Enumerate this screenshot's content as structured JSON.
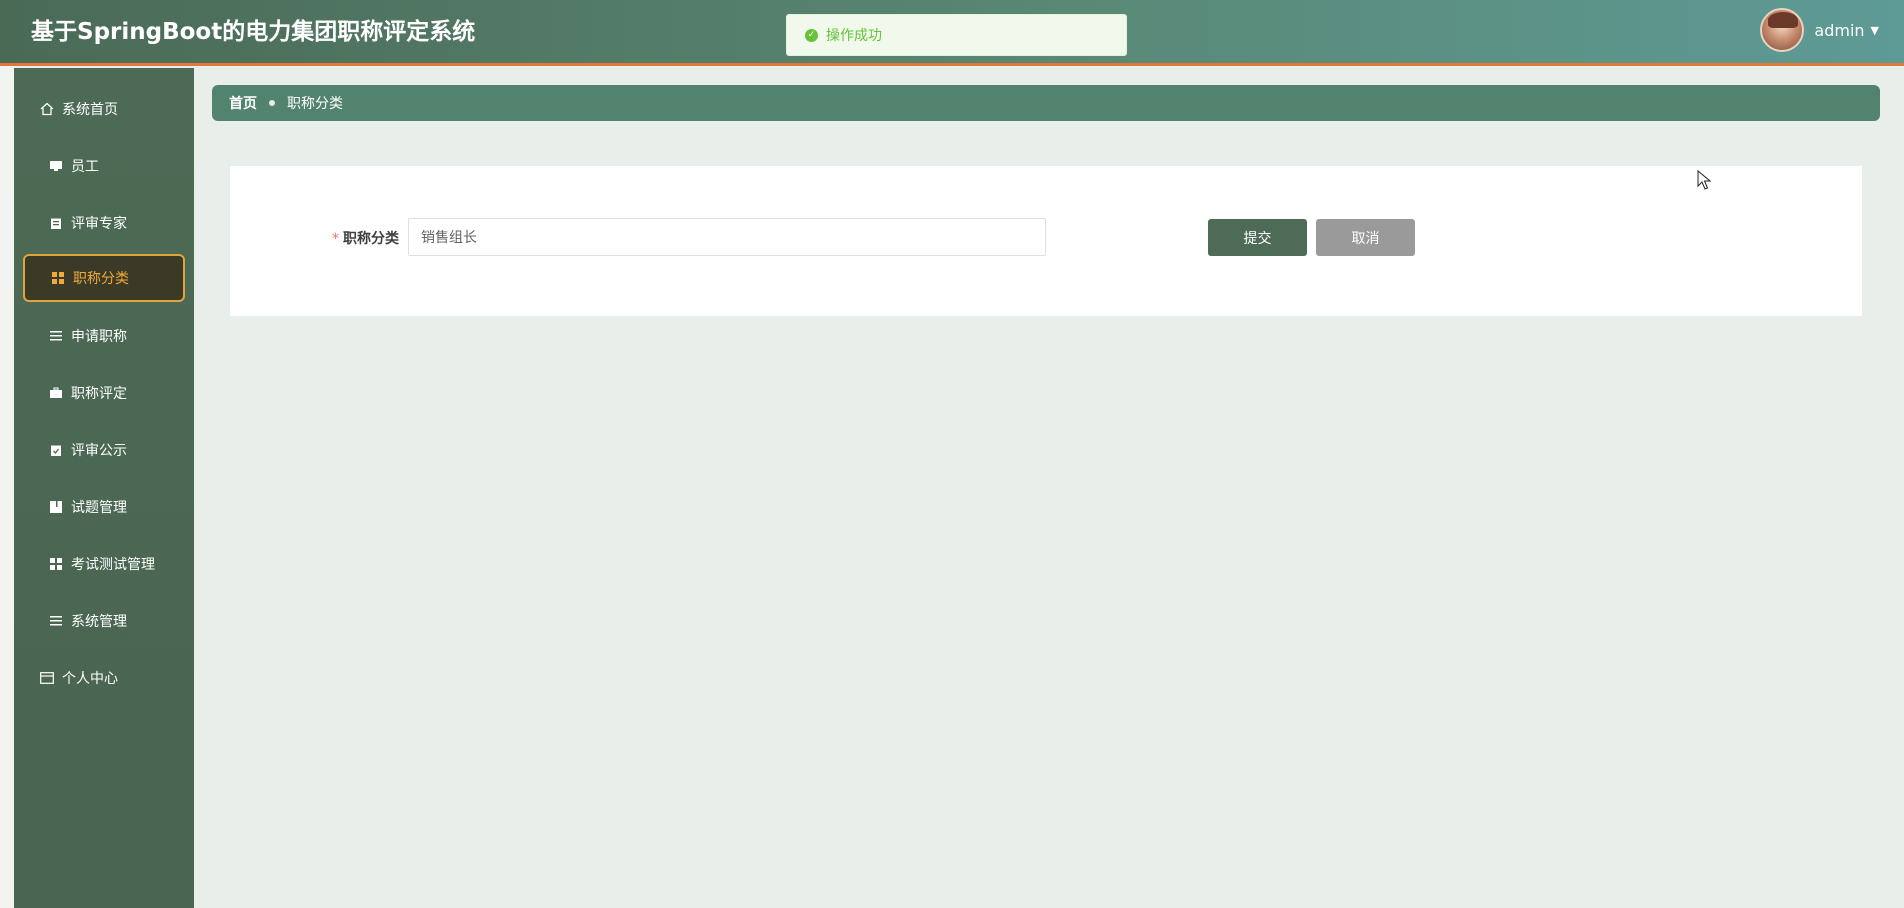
{
  "header": {
    "title": "基于SpringBoot的电力集团职称评定系统",
    "username": "admin"
  },
  "toast": {
    "message": "操作成功"
  },
  "sidebar": {
    "items": [
      {
        "label": "系统首页",
        "icon": "home-icon"
      },
      {
        "label": "员工",
        "icon": "monitor-icon"
      },
      {
        "label": "评审专家",
        "icon": "clipboard-icon"
      },
      {
        "label": "职称分类",
        "icon": "grid-icon",
        "active": true
      },
      {
        "label": "申请职称",
        "icon": "list-icon"
      },
      {
        "label": "职称评定",
        "icon": "briefcase-icon"
      },
      {
        "label": "评审公示",
        "icon": "clipboard-check-icon"
      },
      {
        "label": "试题管理",
        "icon": "book-icon"
      },
      {
        "label": "考试测试管理",
        "icon": "grid-icon"
      },
      {
        "label": "系统管理",
        "icon": "list-icon"
      },
      {
        "label": "个人中心",
        "icon": "card-icon"
      }
    ]
  },
  "breadcrumb": {
    "home": "首页",
    "current": "职称分类"
  },
  "form": {
    "field_label": "职称分类",
    "required_mark": "*",
    "field_value": "销售组长",
    "submit_label": "提交",
    "cancel_label": "取消"
  },
  "colors": {
    "header_gradient_start": "#4a6a56",
    "header_gradient_end": "#5e9a96",
    "sidebar_bg": "#4c6a55",
    "active_accent": "#f0a93a",
    "breadcrumb_bg": "#52836f",
    "submit_bg": "#4d6b56",
    "cancel_bg": "#9a9a9a",
    "success": "#67c23a"
  }
}
